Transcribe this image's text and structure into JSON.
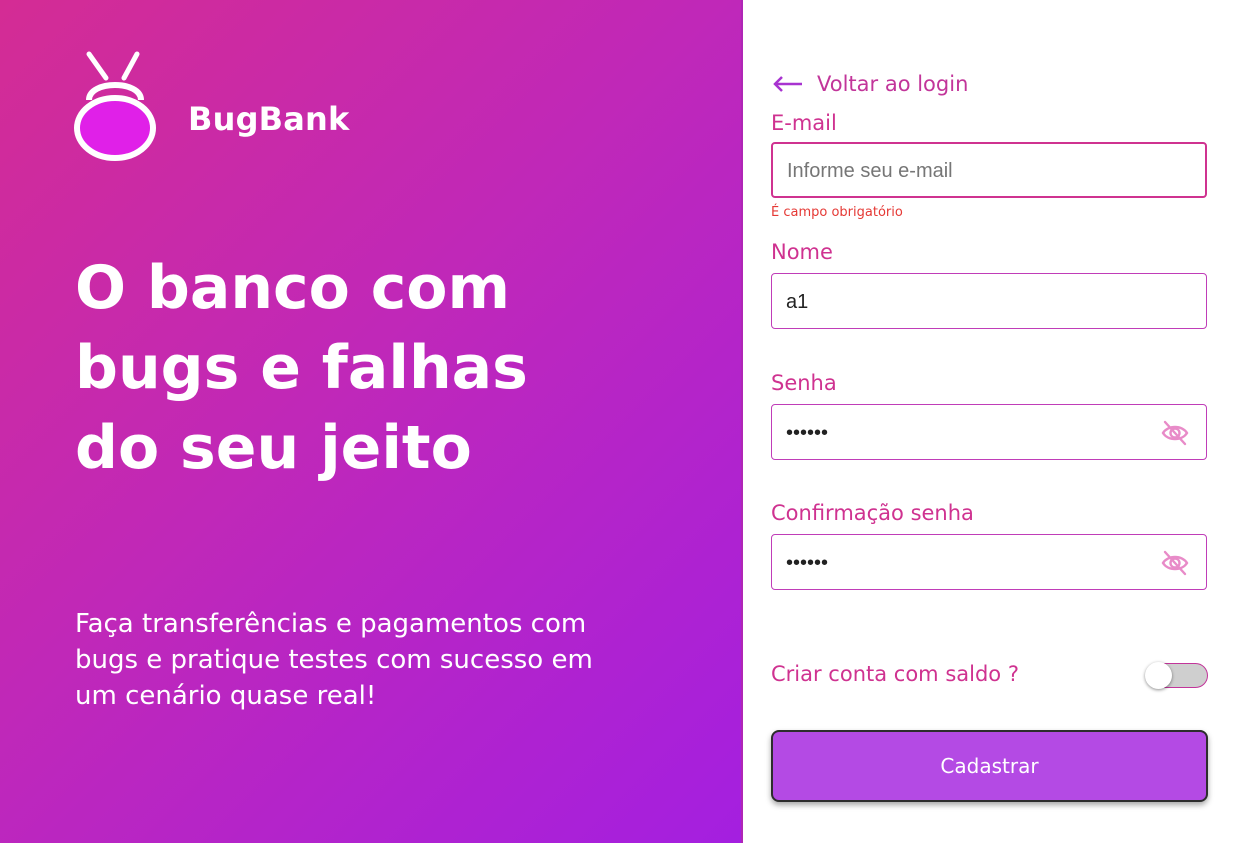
{
  "brand": {
    "name": "BugBank"
  },
  "hero": {
    "headline_lines": [
      "O banco com",
      "bugs e falhas",
      "do seu jeito"
    ],
    "subtitle_lines": [
      "Faça transferências e pagamentos com",
      "bugs e pratique testes com sucesso em",
      "um cenário quase real!"
    ]
  },
  "form": {
    "back_label": "Voltar ao login",
    "email": {
      "label": "E-mail",
      "placeholder": "Informe seu e-mail",
      "value": "",
      "error": "É campo obrigatório"
    },
    "name": {
      "label": "Nome",
      "value": "a1"
    },
    "password": {
      "label": "Senha",
      "value": "••••••"
    },
    "password_confirm": {
      "label": "Confirmação senha",
      "value": "••••••"
    },
    "balance_toggle": {
      "label": "Criar conta com saldo ?",
      "on": false
    },
    "submit_label": "Cadastrar"
  },
  "icons": {
    "back": "arrow-left-icon",
    "eye": "eye-slash-icon",
    "logo": "bug-logo-icon"
  },
  "colors": {
    "gradient_start": "#d42c94",
    "gradient_end": "#a41fe0",
    "accent": "#cf3290",
    "button": "#b44ae4",
    "error": "#e53935"
  }
}
